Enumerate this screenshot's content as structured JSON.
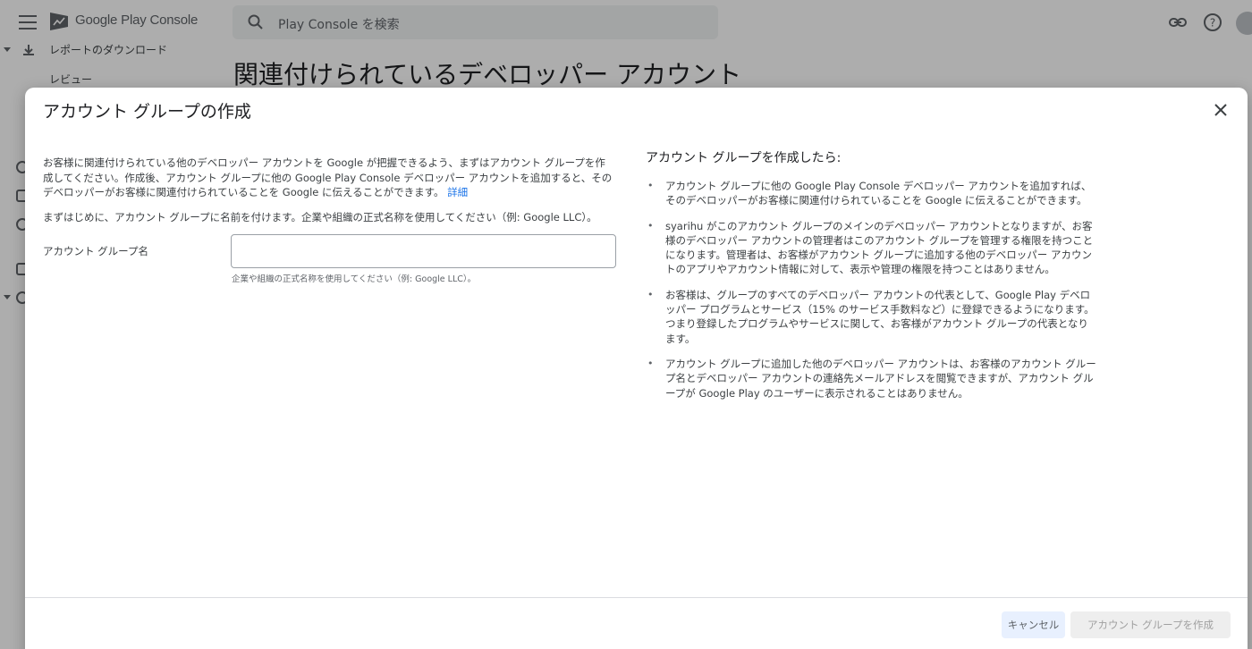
{
  "app": {
    "brand": "Google Play Console",
    "search_placeholder": "Play Console を検索",
    "page_title": "関連付けられているデベロッパー アカウント",
    "nav": [
      {
        "label": "レポートのダウンロード"
      },
      {
        "label": "レビュー"
      }
    ],
    "icons": [
      "menu-icon",
      "play-console-logo",
      "search-icon",
      "download-icon",
      "link-icon",
      "help-icon",
      "avatar"
    ]
  },
  "dialog": {
    "title": "アカウント グループの作成",
    "intro_text": "お客様に関連付けられている他のデベロッパー アカウントを Google が把握できるよう、まずはアカウント グループを作成してください。作成後、アカウント グループに他の Google Play Console デベロッパー アカウントを追加すると、そのデベロッパーがお客様に関連付けられていることを Google に伝えることができます。",
    "intro_link": "詳細",
    "instruction": "まずはじめに、アカウント グループに名前を付けます。企業や組織の正式名称を使用してください（例: Google LLC）。",
    "field": {
      "label": "アカウント グループ名",
      "value": "",
      "helper": "企業や組織の正式名称を使用してください（例: Google LLC）。"
    },
    "right_title": "アカウント グループを作成したら:",
    "bullets": [
      "アカウント グループに他の Google Play Console デベロッパー アカウントを追加すれば、そのデベロッパーがお客様に関連付けられていることを Google に伝えることができます。",
      "syarihu がこのアカウント グループのメインのデベロッパー アカウントとなりますが、お客様のデベロッパー アカウントの管理者はこのアカウント グループを管理する権限を持つことになります。管理者は、お客様がアカウント グループに追加する他のデベロッパー アカウントのアプリやアカウント情報に対して、表示や管理の権限を持つことはありません。",
      "お客様は、グループのすべてのデベロッパー アカウントの代表として、Google Play デベロッパー プログラムとサービス（15% のサービス手数料など）に登録できるようになります。つまり登録したプログラムやサービスに関して、お客様がアカウント グループの代表となります。",
      "アカウント グループに追加した他のデベロッパー アカウントは、お客様のアカウント グループ名とデベロッパー アカウントの連絡先メールアドレスを閲覧できますが、アカウント グループが Google Play のユーザーに表示されることはありません。"
    ],
    "cancel_label": "キャンセル",
    "create_label": "アカウント グループを作成",
    "colors": {
      "link": "#1a73e8",
      "cancel_bg": "#e8f0fe",
      "create_disabled_bg": "#eeeeee"
    }
  }
}
